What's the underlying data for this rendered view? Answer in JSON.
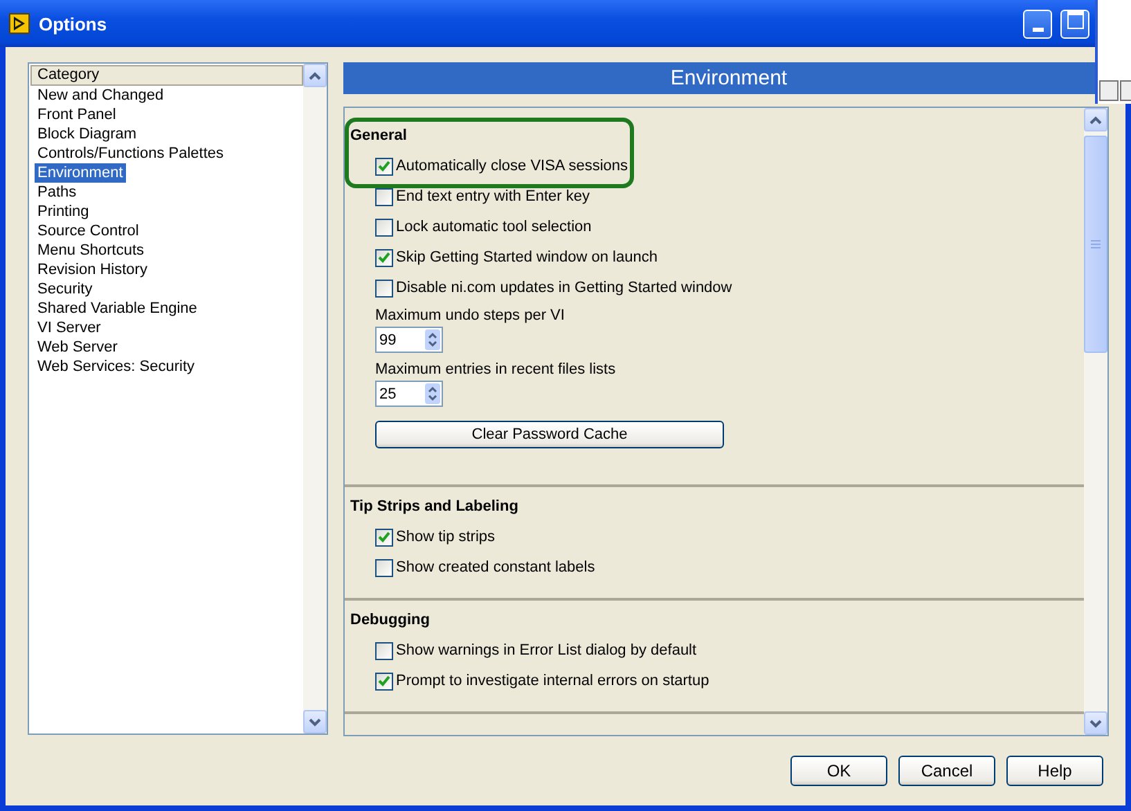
{
  "window": {
    "title": "Options"
  },
  "category_list": {
    "header": "Category",
    "items": [
      {
        "label": "New and Changed",
        "selected": false
      },
      {
        "label": "Front Panel",
        "selected": false
      },
      {
        "label": "Block Diagram",
        "selected": false
      },
      {
        "label": "Controls/Functions Palettes",
        "selected": false
      },
      {
        "label": "Environment",
        "selected": true
      },
      {
        "label": "Paths",
        "selected": false
      },
      {
        "label": "Printing",
        "selected": false
      },
      {
        "label": "Source Control",
        "selected": false
      },
      {
        "label": "Menu Shortcuts",
        "selected": false
      },
      {
        "label": "Revision History",
        "selected": false
      },
      {
        "label": "Security",
        "selected": false
      },
      {
        "label": "Shared Variable Engine",
        "selected": false
      },
      {
        "label": "VI Server",
        "selected": false
      },
      {
        "label": "Web Server",
        "selected": false
      },
      {
        "label": "Web Services: Security",
        "selected": false
      }
    ]
  },
  "panel": {
    "title": "Environment"
  },
  "sections": [
    {
      "title": "General",
      "items": [
        {
          "kind": "checkbox",
          "label": "Automatically close VISA sessions",
          "checked": true,
          "highlighted": true
        },
        {
          "kind": "checkbox",
          "label": "End text entry with Enter key",
          "checked": false,
          "highlighted": false
        },
        {
          "kind": "checkbox",
          "label": "Lock automatic tool selection",
          "checked": false,
          "highlighted": false
        },
        {
          "kind": "checkbox",
          "label": "Skip Getting Started window on launch",
          "checked": true,
          "highlighted": false
        },
        {
          "kind": "checkbox",
          "label": "Disable ni.com updates in Getting Started window",
          "checked": false,
          "highlighted": false
        },
        {
          "kind": "spinner",
          "label": "Maximum undo steps per VI",
          "value": "99"
        },
        {
          "kind": "spinner",
          "label": "Maximum entries in recent files lists",
          "value": "25"
        },
        {
          "kind": "button",
          "label": "Clear Password Cache"
        }
      ]
    },
    {
      "title": "Tip Strips and Labeling",
      "items": [
        {
          "kind": "checkbox",
          "label": "Show tip strips",
          "checked": true,
          "highlighted": false
        },
        {
          "kind": "checkbox",
          "label": "Show created constant labels",
          "checked": false,
          "highlighted": false
        }
      ]
    },
    {
      "title": "Debugging",
      "items": [
        {
          "kind": "checkbox",
          "label": "Show warnings in Error List dialog by default",
          "checked": false,
          "highlighted": false
        },
        {
          "kind": "checkbox",
          "label": "Prompt to investigate internal errors on startup",
          "checked": true,
          "highlighted": false
        }
      ]
    }
  ],
  "buttons": [
    "OK",
    "Cancel",
    "Help"
  ]
}
